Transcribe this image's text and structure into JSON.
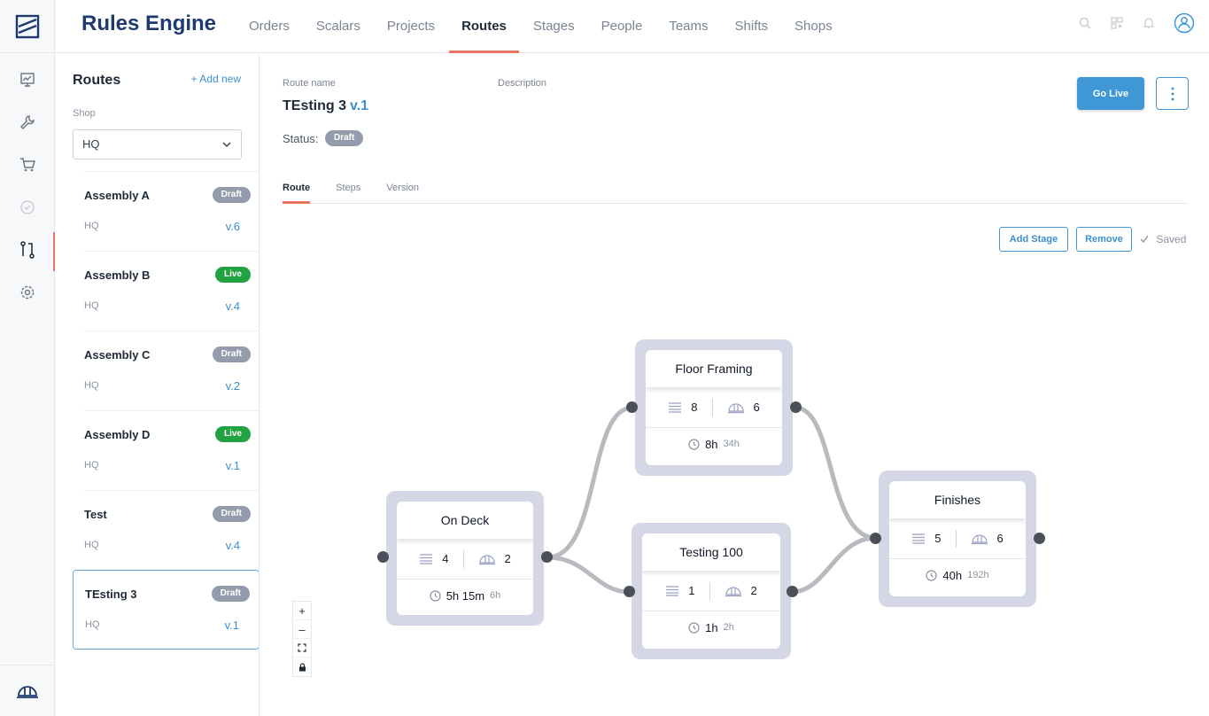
{
  "app": {
    "title": "Rules Engine"
  },
  "topnav": [
    "Orders",
    "Scalars",
    "Projects",
    "Routes",
    "Stages",
    "People",
    "Teams",
    "Shifts",
    "Shops"
  ],
  "topnav_active": "Routes",
  "rail_icons": [
    "chart-presentation-icon",
    "wrench-icon",
    "cart-icon",
    "check-circle-icon",
    "route-icon",
    "gear-icon"
  ],
  "sidebar": {
    "title": "Routes",
    "add_new": "+ Add new",
    "shop_label": "Shop",
    "shop_value": "HQ",
    "items": [
      {
        "name": "Assembly A",
        "shop": "HQ",
        "version": "v.6",
        "status": "Draft"
      },
      {
        "name": "Assembly B",
        "shop": "HQ",
        "version": "v.4",
        "status": "Live"
      },
      {
        "name": "Assembly C",
        "shop": "HQ",
        "version": "v.2",
        "status": "Draft"
      },
      {
        "name": "Assembly D",
        "shop": "HQ",
        "version": "v.1",
        "status": "Live"
      },
      {
        "name": "Test",
        "shop": "HQ",
        "version": "v.4",
        "status": "Draft"
      },
      {
        "name": "TEsting 3",
        "shop": "HQ",
        "version": "v.1",
        "status": "Draft"
      }
    ]
  },
  "detail": {
    "route_name_label": "Route name",
    "description_label": "Description",
    "route_name": "TEsting 3",
    "version": "v.1",
    "status_label": "Status:",
    "status": "Draft",
    "go_live": "Go Live",
    "tabs": [
      "Route",
      "Steps",
      "Version"
    ],
    "active_tab": "Route",
    "add_stage": "Add Stage",
    "remove": "Remove",
    "saved": "Saved"
  },
  "stages": [
    {
      "name": "On Deck",
      "steps": "4",
      "workers": "2",
      "time": "5h 15m",
      "total": "6h"
    },
    {
      "name": "Floor Framing",
      "steps": "8",
      "workers": "6",
      "time": "8h",
      "total": "34h"
    },
    {
      "name": "Testing 100",
      "steps": "1",
      "workers": "2",
      "time": "1h",
      "total": "2h"
    },
    {
      "name": "Finishes",
      "steps": "5",
      "workers": "6",
      "time": "40h",
      "total": "192h"
    }
  ],
  "zoom_controls": [
    "+",
    "–"
  ],
  "colors": {
    "accent": "#e8735f",
    "primary": "#3f97d5",
    "live": "#22a243",
    "draft": "#949bad",
    "stage_frame": "#d6d7e6"
  }
}
